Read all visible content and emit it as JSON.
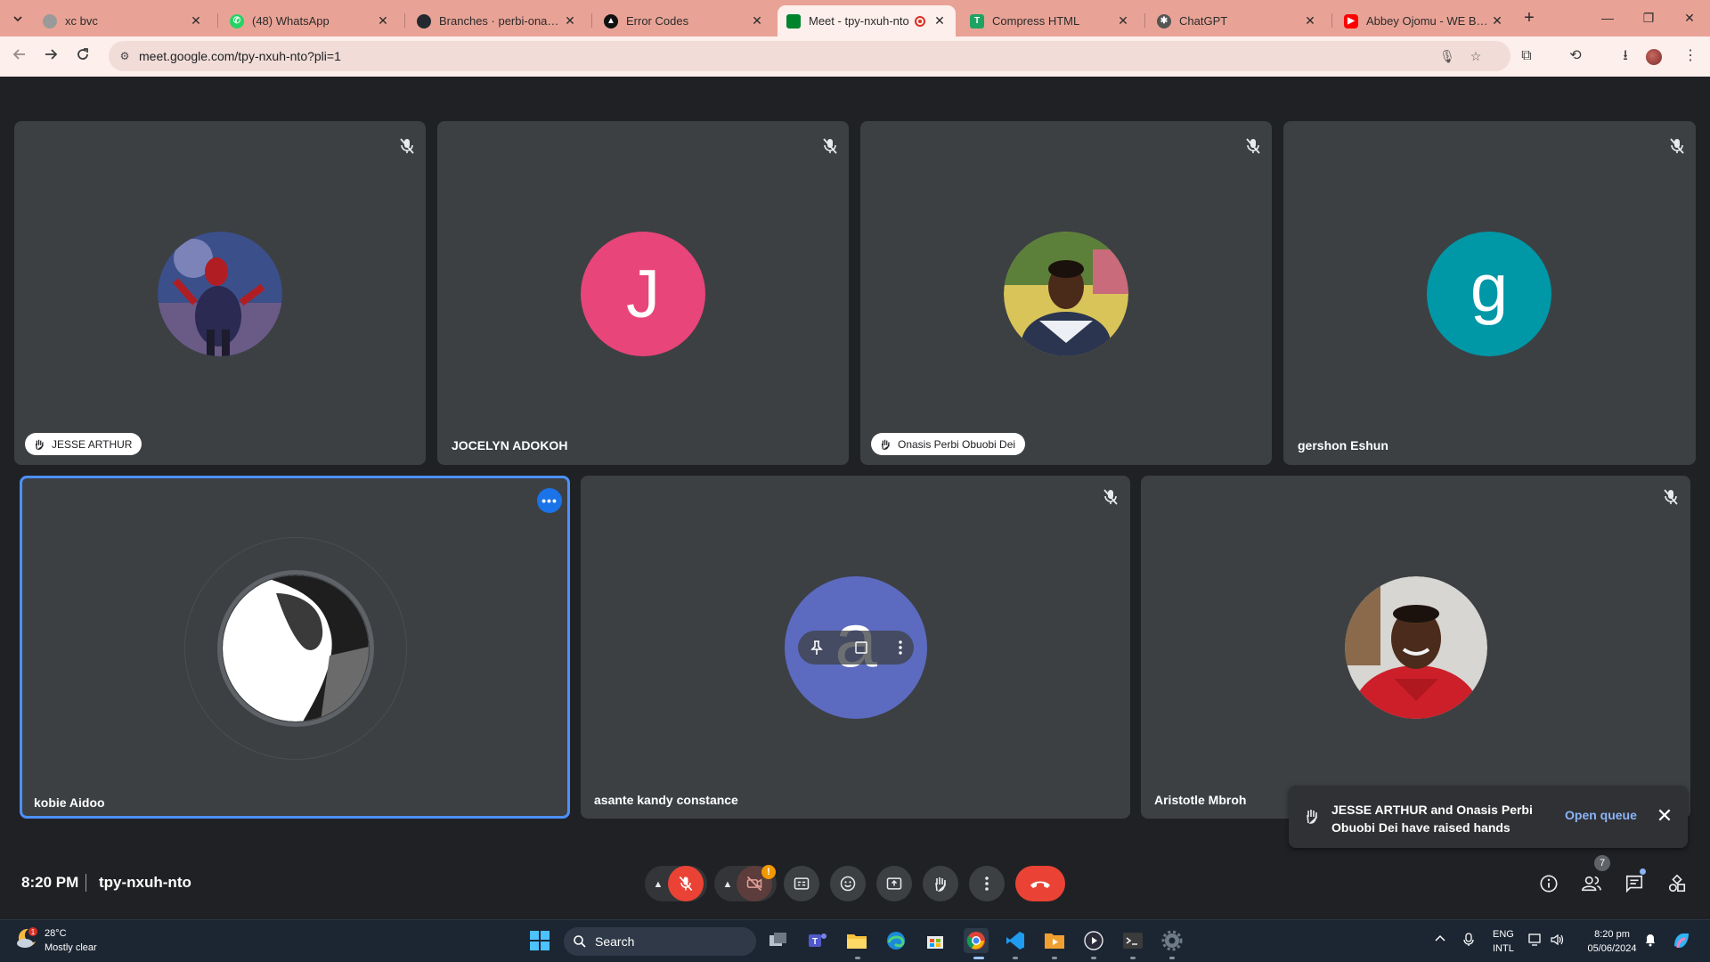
{
  "browser": {
    "tabs": [
      {
        "title": "xc bvc",
        "favicon": "generic-globe-icon",
        "color": "#8a8a8a"
      },
      {
        "title": "(48) WhatsApp",
        "favicon": "whatsapp-icon",
        "color": "#25d366"
      },
      {
        "title": "Branches · perbi-onasis/iz",
        "favicon": "github-icon",
        "color": "#24292f"
      },
      {
        "title": "Error Codes",
        "favicon": "error-codes-icon",
        "color": "#111111"
      },
      {
        "title": "Meet - tpy-nxuh-nto",
        "favicon": "google-meet-icon",
        "color": "#00832d",
        "active": true,
        "recording": true
      },
      {
        "title": "Compress HTML",
        "favicon": "compress-html-icon",
        "color": "#1ea362"
      },
      {
        "title": "ChatGPT",
        "favicon": "chatgpt-icon",
        "color": "#444444"
      },
      {
        "title": "Abbey Ojomu - WE BEHO",
        "favicon": "youtube-icon",
        "color": "#ff0000"
      }
    ],
    "url": "meet.google.com/tpy-nxuh-nto?pli=1",
    "tab_strip_color": "#e8a396"
  },
  "meet": {
    "participants": [
      {
        "name": "JESSE ARTHUR",
        "avatar_type": "photo",
        "avatar_desc": "spider-man-avatar",
        "hand_raised": true,
        "muted": true
      },
      {
        "name": "JOCELYN ADOKOH",
        "avatar_type": "initial",
        "initial": "J",
        "avatar_color": "#e8457a",
        "hand_raised": false,
        "muted": true
      },
      {
        "name": "Onasis Perbi Obuobi Dei",
        "avatar_type": "photo",
        "avatar_desc": "portrait-avatar",
        "hand_raised": true,
        "muted": true
      },
      {
        "name": "gershon Eshun",
        "avatar_type": "initial",
        "initial": "g",
        "avatar_color": "#0097a7",
        "hand_raised": false,
        "muted": true
      },
      {
        "name": "kobie Aidoo",
        "avatar_type": "photo",
        "avatar_desc": "bw-portrait-avatar",
        "hand_raised": false,
        "muted": false,
        "speaking": true
      },
      {
        "name": "asante kandy constance",
        "avatar_type": "initial",
        "initial": "a",
        "avatar_color": "#5c6bc0",
        "hand_raised": false,
        "muted": true
      },
      {
        "name": "Aristotle Mbroh",
        "avatar_type": "photo",
        "avatar_desc": "red-shirt-portrait-avatar",
        "hand_raised": false,
        "muted": true
      }
    ],
    "toast": {
      "message": "JESSE ARTHUR and Onasis Perbi Obuobi Dei have raised hands",
      "action": "Open queue"
    },
    "time": "8:20 PM",
    "meeting_code": "tpy-nxuh-nto",
    "people_count": "7",
    "controls": [
      "mic-off",
      "camera-off",
      "captions",
      "emoji",
      "present",
      "raise-hand",
      "more-options",
      "leave-call"
    ],
    "side_controls": [
      "meeting-info",
      "people",
      "chat",
      "activities"
    ]
  },
  "taskbar": {
    "weather_temp": "28°C",
    "weather_desc": "Mostly clear",
    "weather_badge": "1",
    "search_label": "Search",
    "lang_top": "ENG",
    "lang_bottom": "INTL",
    "clock_time": "8:20 pm",
    "clock_date": "05/06/2024"
  },
  "colors": {
    "tile_bg": "#3c4043",
    "stage_bg": "#202124",
    "speaking_border": "#4d90fe",
    "leave_red": "#ea4335",
    "link_blue": "#8ab4f8"
  }
}
